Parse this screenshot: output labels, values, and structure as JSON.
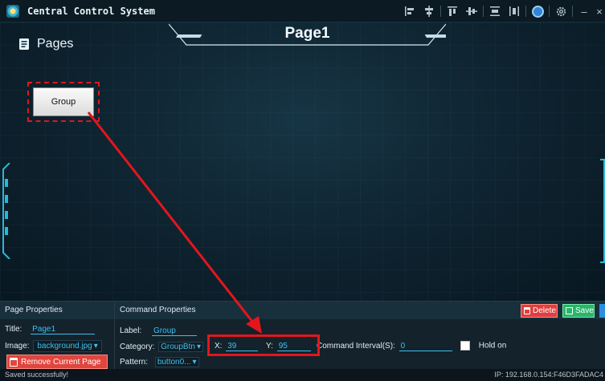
{
  "titlebar": {
    "title": "Central Control System",
    "icons": [
      "align-left-icon",
      "align-center-icon",
      "align-top-icon",
      "align-middle-icon",
      "distribute-vertical-icon",
      "distribute-horizontal-icon",
      "globe-icon",
      "settings-icon",
      "minimize-icon",
      "close-icon"
    ],
    "minimize": "–",
    "close": "×"
  },
  "stage": {
    "pages_label": "Pages",
    "page_name": "Page1",
    "group_button_label": "Group"
  },
  "page_properties": {
    "header": "Page Properties",
    "title_label": "Title:",
    "title_value": "Page1",
    "image_label": "Image:",
    "image_value": "background.jpg",
    "remove_label": "Remove Current Page"
  },
  "command_properties": {
    "header": "Command Properties",
    "delete_label": "Delete",
    "save_label": "Save",
    "label_label": "Label:",
    "label_value": "Group",
    "category_label": "Category:",
    "category_value": "GroupBtn",
    "x_label": "X:",
    "x_value": "39",
    "y_label": "Y:",
    "y_value": "95",
    "interval_label": "Command Interval(S):",
    "interval_value": "0",
    "hold_on_label": "Hold on",
    "pattern_label": "Pattern:",
    "pattern_value": "button0..."
  },
  "status": {
    "message": "Saved successfully!",
    "ip": "IP:  192.168.0.154:F46D3FADAC4"
  },
  "colors": {
    "accent": "#3ec0ee",
    "annotation_red": "#e3161c",
    "delete_red": "#df3f3f",
    "save_green": "#28b66a"
  }
}
